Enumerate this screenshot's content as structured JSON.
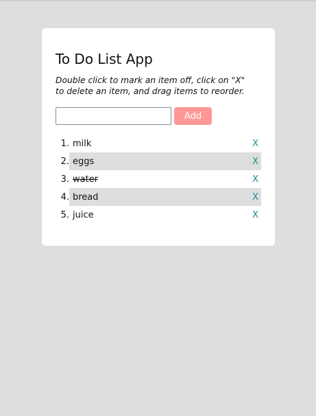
{
  "app": {
    "title": "To Do List App",
    "instructions": "Double click to mark an item off, click on \"X\" to delete an item, and drag items to reorder."
  },
  "form": {
    "input_value": "",
    "input_placeholder": "",
    "add_label": "Add"
  },
  "todos": [
    {
      "number": "1.",
      "text": "milk",
      "done": false,
      "delete_label": "X"
    },
    {
      "number": "2.",
      "text": "eggs",
      "done": false,
      "delete_label": "X"
    },
    {
      "number": "3.",
      "text": "water",
      "done": true,
      "delete_label": "X"
    },
    {
      "number": "4.",
      "text": "bread",
      "done": false,
      "delete_label": "X"
    },
    {
      "number": "5.",
      "text": "juice",
      "done": false,
      "delete_label": "X"
    }
  ],
  "colors": {
    "background": "#dedede",
    "card": "#ffffff",
    "add_button": "#ff9797",
    "delete_x": "#1a8a96",
    "shaded_row": "#dedede"
  }
}
